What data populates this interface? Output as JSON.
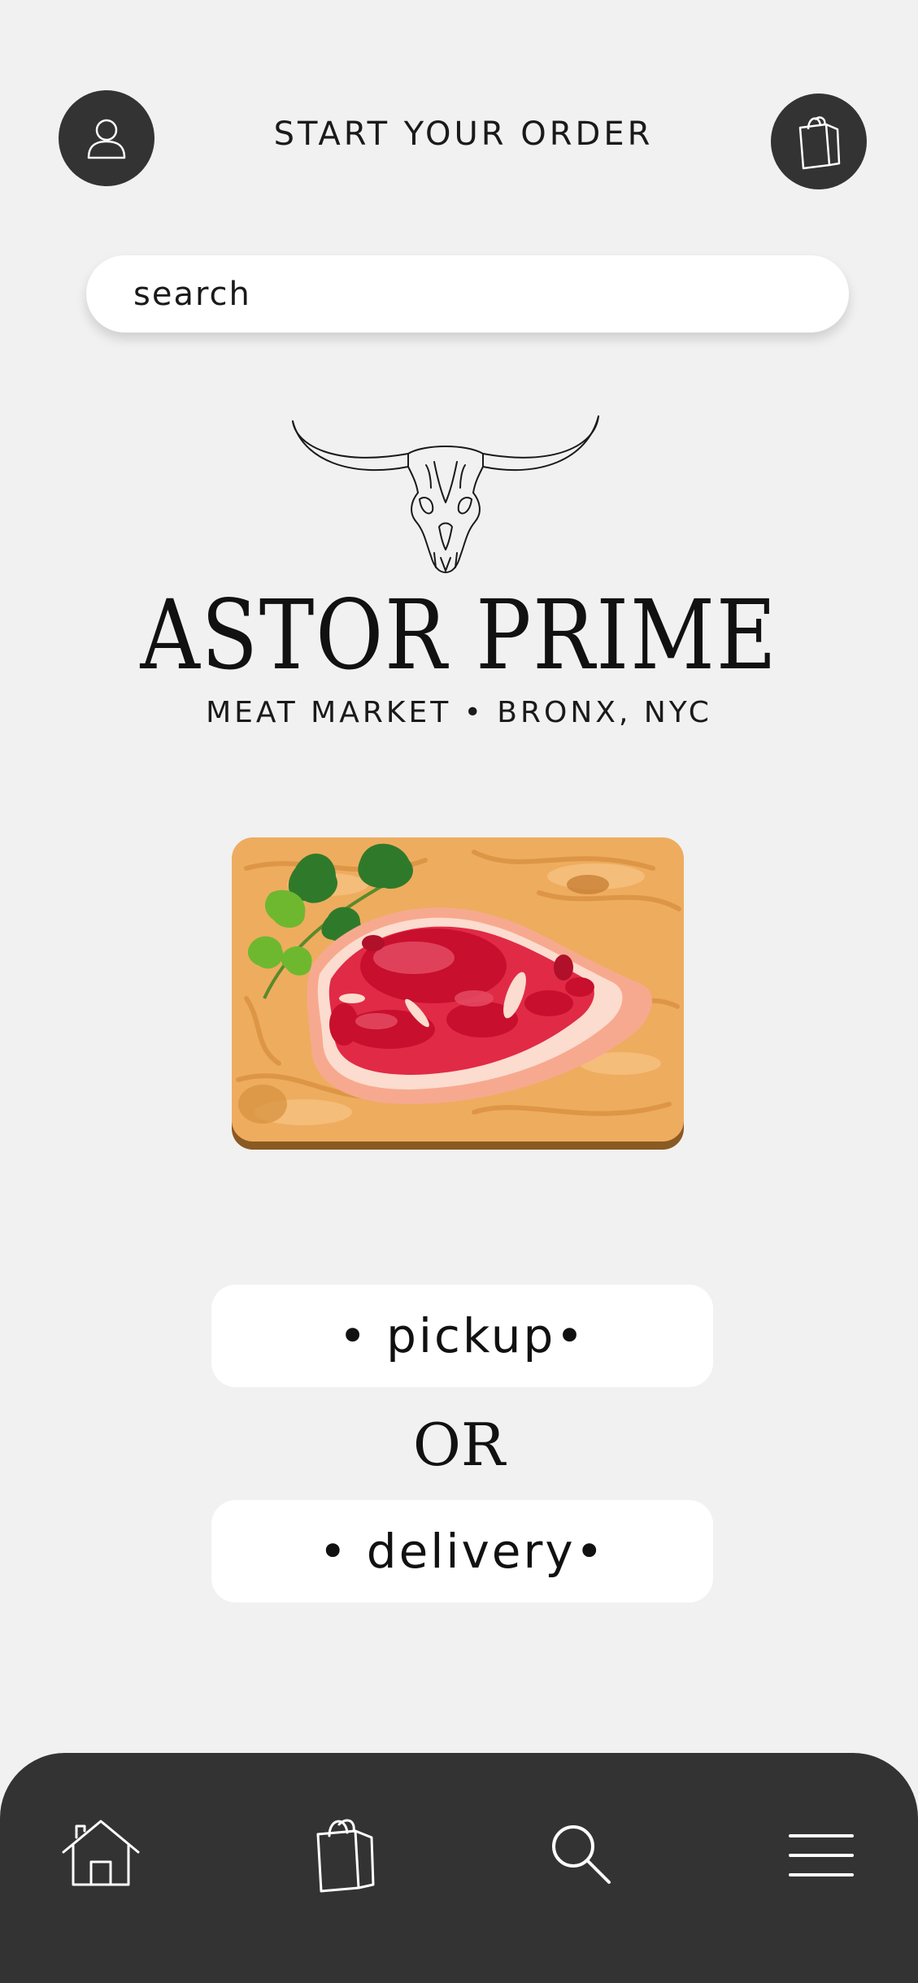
{
  "header": {
    "title": "START YOUR ORDER",
    "profile_icon": "user-icon",
    "bag_icon": "shopping-bag-icon"
  },
  "search": {
    "placeholder": "search"
  },
  "brand": {
    "logo_icon": "longhorn-skull-icon",
    "name": "ASTOR PRIME",
    "subtitle": "MEAT MARKET • BRONX, NYC"
  },
  "hero": {
    "image": "steak-on-cutting-board-illustration"
  },
  "options": {
    "pickup_label": "• pickup•",
    "separator": "OR",
    "delivery_label": "• delivery•"
  },
  "bottom_nav": {
    "items": [
      {
        "icon": "home-icon"
      },
      {
        "icon": "shopping-bag-icon"
      },
      {
        "icon": "search-icon"
      },
      {
        "icon": "menu-icon"
      }
    ]
  },
  "colors": {
    "background": "#f1f1f1",
    "dark": "#333333",
    "white": "#ffffff"
  }
}
